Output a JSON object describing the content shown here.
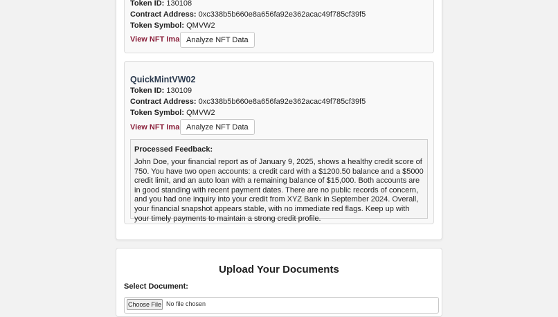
{
  "cards": [
    {
      "token_id_label": "Token ID:",
      "token_id": "130108",
      "contract_label": "Contract Address:",
      "contract": "0xc338b5b660e8a656fa92e362acac49f785cf39f5",
      "symbol_label": "Token Symbol:",
      "symbol": "QMVW2",
      "view_link": "View NFT Image",
      "analyze_button": "Analyze NFT Data"
    },
    {
      "title": "QuickMintVW02",
      "token_id_label": "Token ID:",
      "token_id": "130109",
      "contract_label": "Contract Address:",
      "contract": "0xc338b5b660e8a656fa92e362acac49f785cf39f5",
      "symbol_label": "Token Symbol:",
      "symbol": "QMVW2",
      "view_link": "View NFT Image",
      "analyze_button": "Analyze NFT Data",
      "feedback": {
        "title": "Processed Feedback:",
        "body": "John Doe, your financial report as of January 9, 2025, shows a healthy credit score of 750. You have two open accounts: a credit card with a $1200.50 balance and a $5000 credit limit, and an auto loan with a remaining balance of $15,000. Both accounts are in good standing with recent payment dates. There are no public records of concern, and you had one inquiry into your credit from XYZ Bank in September 2024. Overall, your financial snapshot appears stable, with no immediate red flags. Keep up with your timely payments to maintain a strong credit profile."
      }
    }
  ],
  "upload": {
    "title": "Upload Your Documents",
    "select_label": "Select Document:",
    "choose_button": "Choose File",
    "file_status": "No file chosen"
  },
  "colors": {
    "link": "#8a1f3a",
    "card_title": "#2b3a4e",
    "background": "#f2f2f2"
  }
}
